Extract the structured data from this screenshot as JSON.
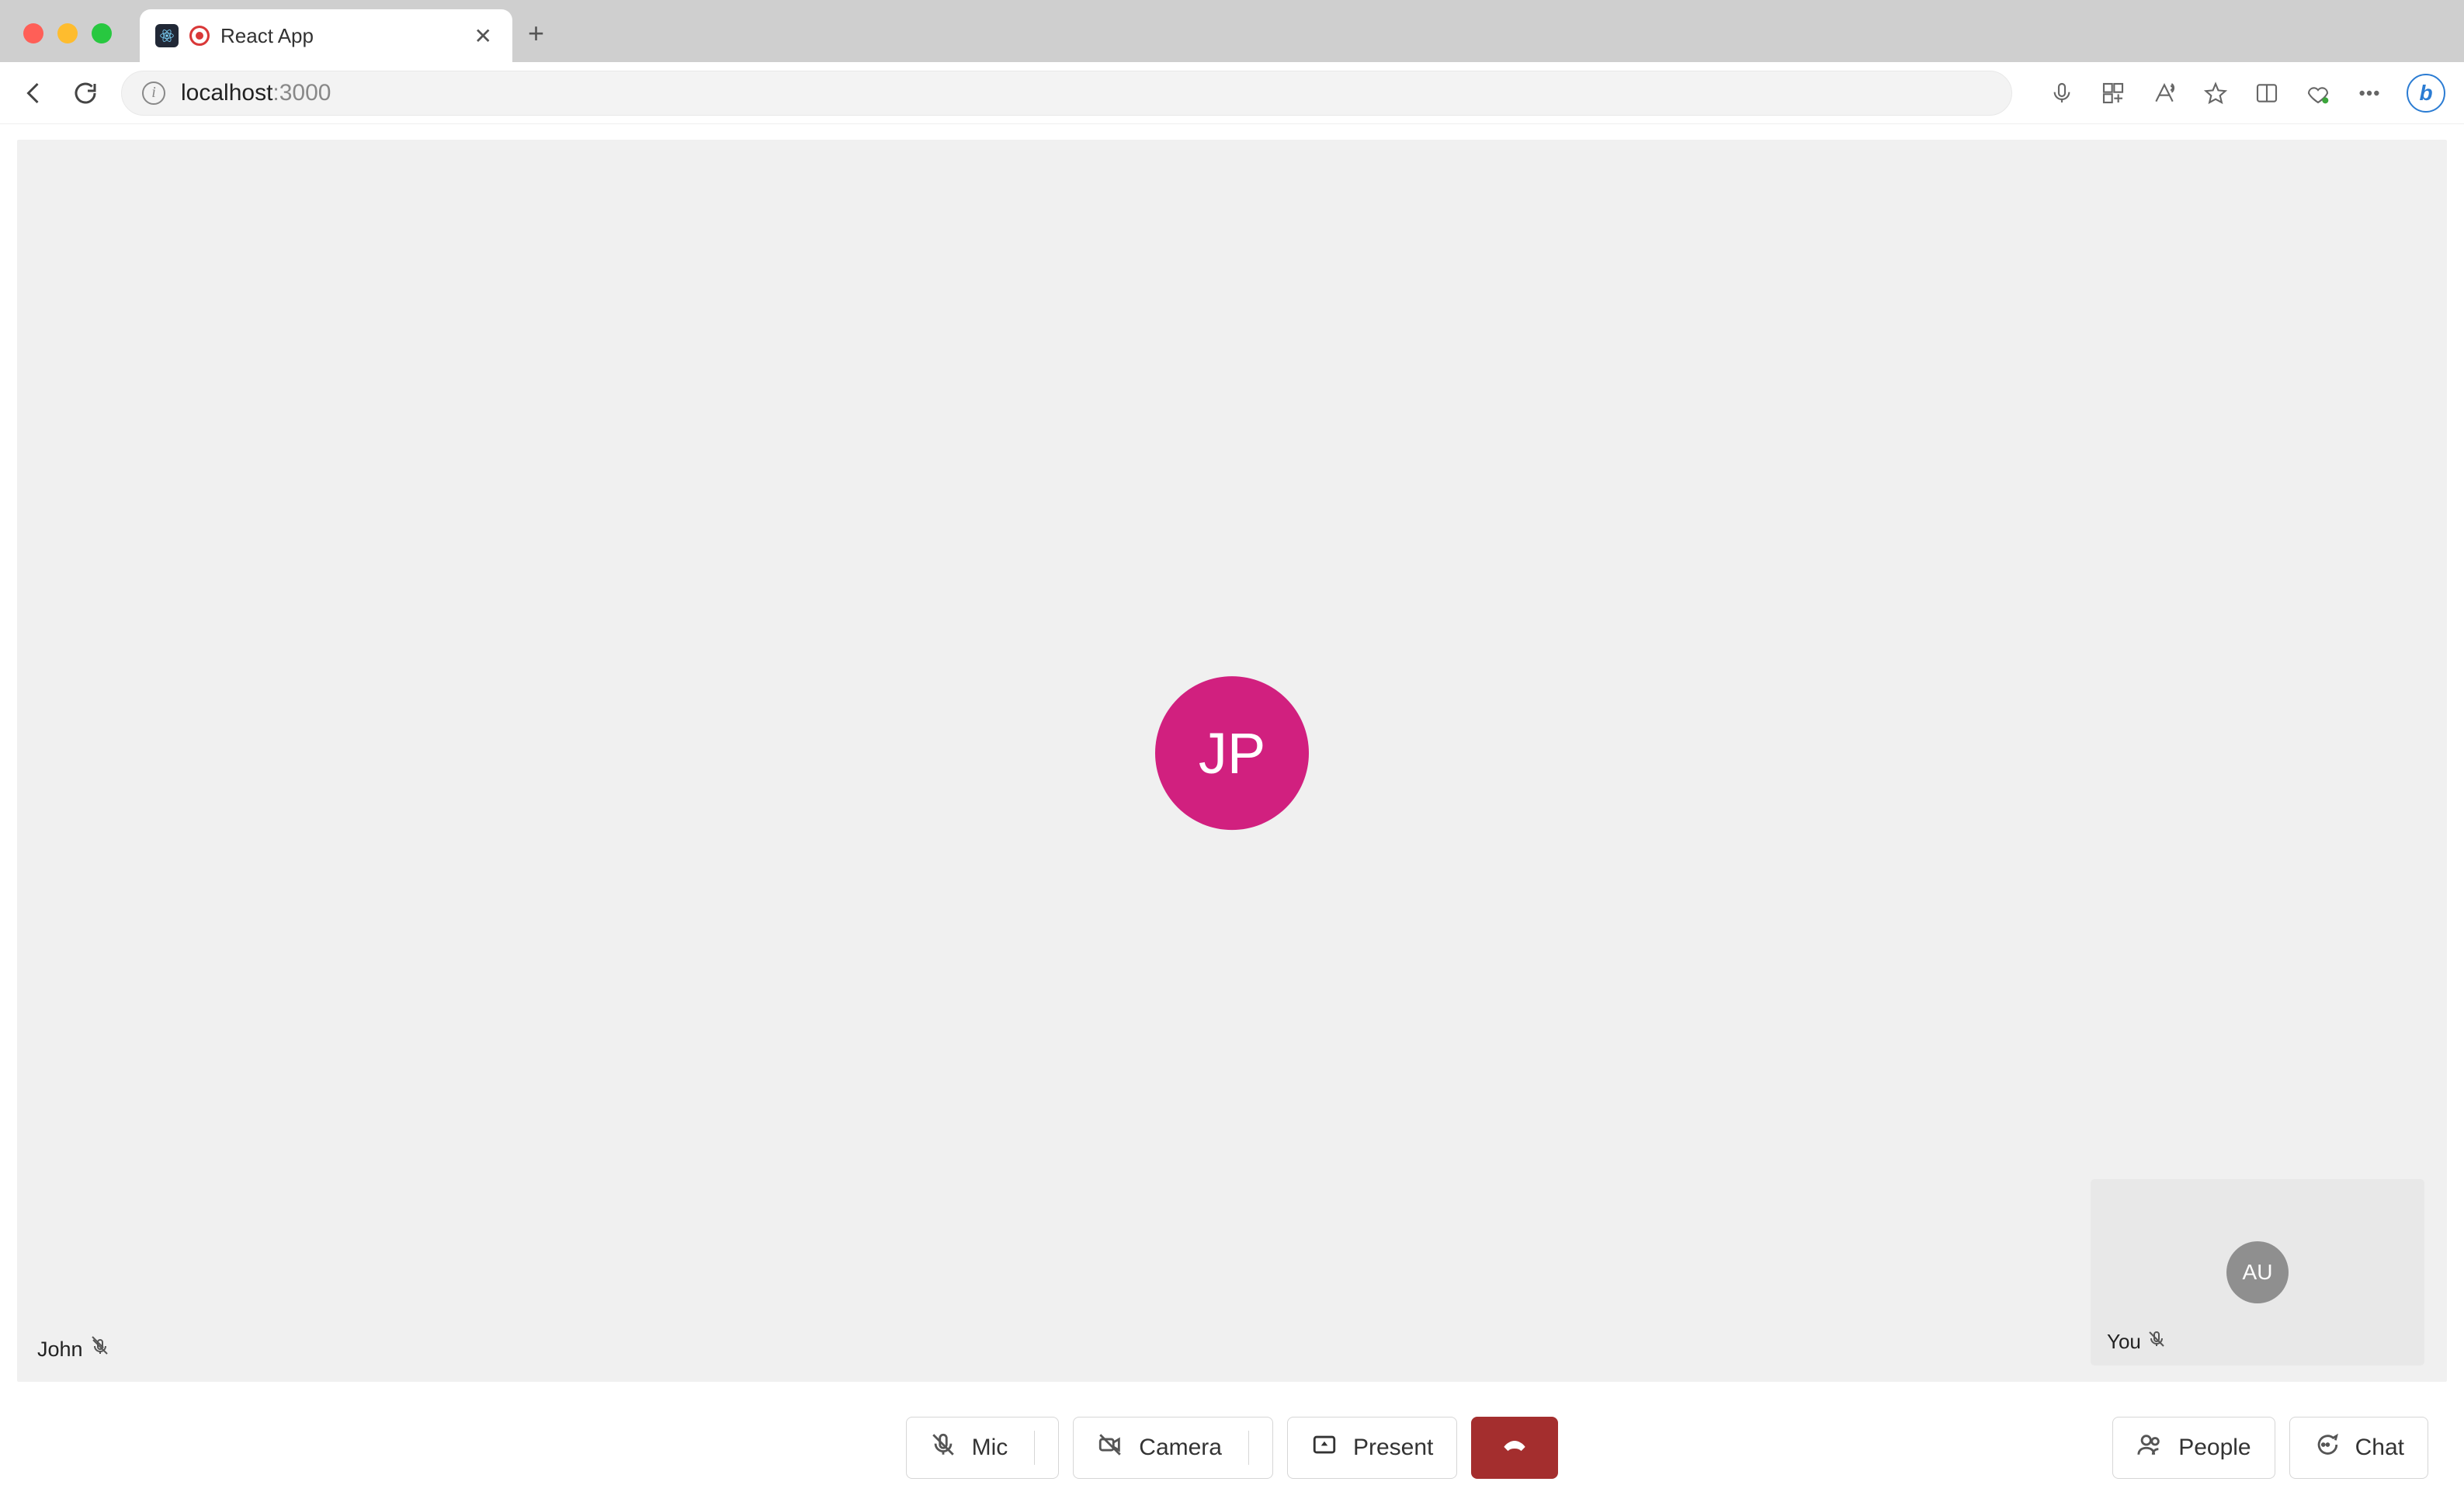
{
  "browser": {
    "tab_title": "React App",
    "url_host": "localhost",
    "url_port": ":3000"
  },
  "stage": {
    "main_participant": {
      "initials": "JP",
      "name": "John",
      "avatar_color": "#d1207f",
      "mic_muted": true
    },
    "self": {
      "initials": "AU",
      "name": "You",
      "avatar_color": "#8f8f8f",
      "mic_muted": true
    }
  },
  "controls": {
    "mic_label": "Mic",
    "camera_label": "Camera",
    "present_label": "Present",
    "people_label": "People",
    "chat_label": "Chat"
  }
}
